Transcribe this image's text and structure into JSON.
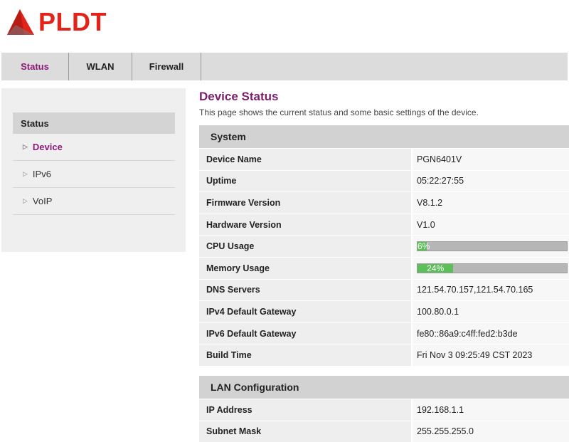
{
  "brand": {
    "name": "PLDT",
    "color": "#e2231a",
    "logo_icon": "pldt-triangle-logo"
  },
  "topnav": {
    "tabs": [
      {
        "label": "Status",
        "active": true
      },
      {
        "label": "WLAN",
        "active": false
      },
      {
        "label": "Firewall",
        "active": false
      }
    ]
  },
  "sidebar": {
    "heading": "Status",
    "items": [
      {
        "label": "Device",
        "active": true
      },
      {
        "label": "IPv6",
        "active": false
      },
      {
        "label": "VoIP",
        "active": false
      }
    ]
  },
  "main": {
    "title": "Device Status",
    "description": "This page shows the current status and some basic settings of the device."
  },
  "system": {
    "heading": "System",
    "rows": {
      "device_name": {
        "label": "Device Name",
        "value": "PGN6401V"
      },
      "uptime": {
        "label": "Uptime",
        "value": "05:22:27:55"
      },
      "firmware": {
        "label": "Firmware Version",
        "value": "V8.1.2"
      },
      "hardware": {
        "label": "Hardware Version",
        "value": "V1.0"
      },
      "cpu": {
        "label": "CPU Usage",
        "value": "6%",
        "percent": 6
      },
      "memory": {
        "label": "Memory Usage",
        "value": "24%",
        "percent": 24
      },
      "dns": {
        "label": "DNS Servers",
        "value": "121.54.70.157,121.54.70.165"
      },
      "ipv4_gw": {
        "label": "IPv4 Default Gateway",
        "value": "100.80.0.1"
      },
      "ipv6_gw": {
        "label": "IPv6 Default Gateway",
        "value": "fe80::86a9:c4ff:fed2:b3de"
      },
      "build_time": {
        "label": "Build Time",
        "value": "Fri Nov 3 09:25:49 CST 2023"
      }
    }
  },
  "lan": {
    "heading": "LAN Configuration",
    "rows": {
      "ip": {
        "label": "IP Address",
        "value": "192.168.1.1"
      },
      "mask": {
        "label": "Subnet Mask",
        "value": "255.255.255.0"
      }
    }
  },
  "colors": {
    "accent": "#8b1a7a",
    "progress_fill": "#5cbf5a",
    "progress_track": "#b6b6b6"
  }
}
